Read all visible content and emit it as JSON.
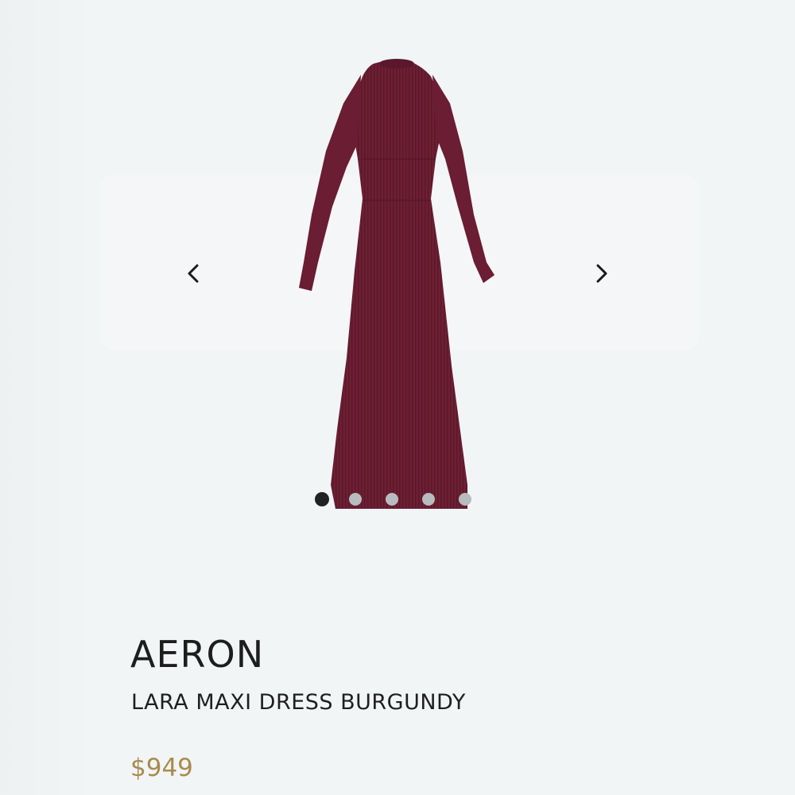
{
  "carousel": {
    "image_alt": "Lara maxi dress in burgundy",
    "prev_icon": "chevron-left-icon",
    "next_icon": "chevron-right-icon",
    "slide_count": 5,
    "active_index": 0
  },
  "product": {
    "brand": "AERON",
    "name": "LARA MAXI DRESS BURGUNDY",
    "price": "$949"
  },
  "colors": {
    "dress": "#6e1f35",
    "price": "#a88b4f",
    "dot_active": "#222222",
    "dot_inactive": "#b9bcbe"
  }
}
